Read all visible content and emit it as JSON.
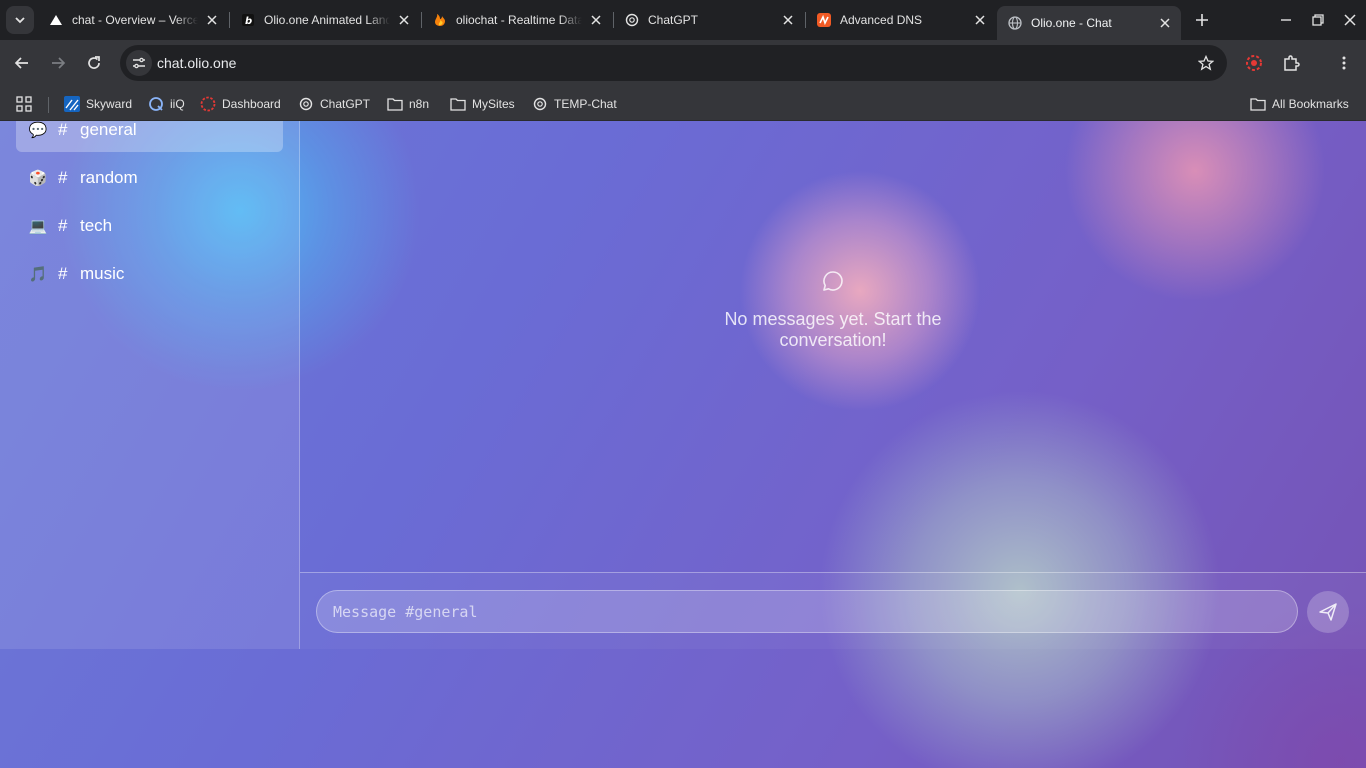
{
  "browser": {
    "tabs": [
      {
        "title": "chat - Overview – Vercel",
        "favicon": "vercel-icon"
      },
      {
        "title": "Olio.one Animated Landing",
        "favicon": "bolt-icon"
      },
      {
        "title": "oliochat - Realtime Database",
        "favicon": "firebase-icon"
      },
      {
        "title": "ChatGPT",
        "favicon": "openai-icon"
      },
      {
        "title": "Advanced DNS",
        "favicon": "namecheap-icon"
      },
      {
        "title": "Olio.one - Chat",
        "favicon": "globe-icon",
        "active": true
      }
    ],
    "url": "chat.olio.one",
    "bookmarks": [
      {
        "label": "Skyward",
        "icon": "skyward-icon"
      },
      {
        "label": "iiQ",
        "icon": "iiq-icon"
      },
      {
        "label": "Dashboard",
        "icon": "dashboard-icon"
      },
      {
        "label": "ChatGPT",
        "icon": "openai-icon"
      },
      {
        "label": "n8n",
        "icon": "folder-icon"
      },
      {
        "label": "MySites",
        "icon": "folder-icon"
      },
      {
        "label": "TEMP-Chat",
        "icon": "openai-icon"
      }
    ],
    "all_bookmarks_label": "All Bookmarks"
  },
  "chat": {
    "channels": [
      {
        "emoji": "💬",
        "hash": "#",
        "name": "general",
        "active": true
      },
      {
        "emoji": "🎲",
        "hash": "#",
        "name": "random"
      },
      {
        "emoji": "💻",
        "hash": "#",
        "name": "tech"
      },
      {
        "emoji": "🎵",
        "hash": "#",
        "name": "music"
      }
    ],
    "empty_state": "No messages yet. Start the conversation!",
    "input_placeholder": "Message #general"
  },
  "colors": {
    "accent_blue": "#50b9f5",
    "accent_purple": "#6a6cd5",
    "accent_pink": "#ea96b4"
  }
}
